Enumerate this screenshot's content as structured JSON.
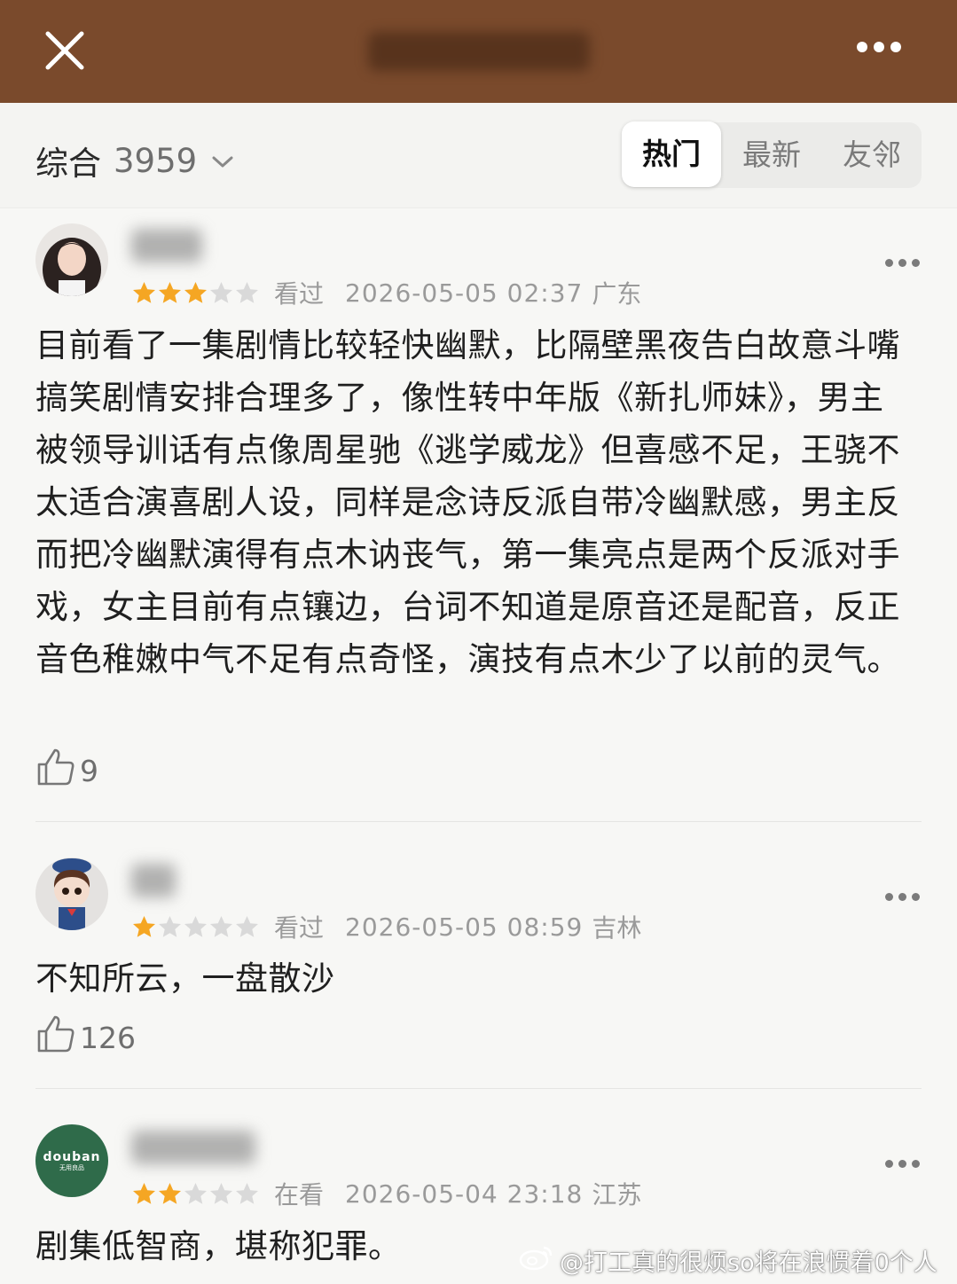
{
  "header": {
    "close_icon": "close-icon",
    "more_icon": "more-horizontal-icon",
    "background": "#7a4a2c"
  },
  "filter": {
    "sort_label": "综合",
    "count": "3959",
    "tabs": [
      {
        "label": "热门",
        "active": true
      },
      {
        "label": "最新",
        "active": false
      },
      {
        "label": "友邻",
        "active": false
      }
    ]
  },
  "reviews": [
    {
      "rating": 3,
      "max_rating": 5,
      "status": "看过",
      "timestamp": "2026-05-05 02:37",
      "location": "广东",
      "text": "目前看了一集剧情比较轻快幽默，比隔壁黑夜告白故意斗嘴搞笑剧情安排合理多了，像性转中年版《新扎师妹》，男主被领导训话有点像周星驰《逃学威龙》但喜感不足，王骁不太适合演喜剧人设，同样是念诗反派自带冷幽默感，男主反而把冷幽默演得有点木讷丧气，第一集亮点是两个反派对手戏，女主目前有点镶边，台词不知道是原音还是配音，反正音色稚嫩中气不足有点奇怪，演技有点木少了以前的灵气。",
      "likes": "9"
    },
    {
      "rating": 1,
      "max_rating": 5,
      "status": "看过",
      "timestamp": "2026-05-05 08:59",
      "location": "吉林",
      "text": "不知所云，一盘散沙",
      "likes": "126"
    },
    {
      "rating": 2,
      "max_rating": 5,
      "status": "在看",
      "timestamp": "2026-05-04 23:18",
      "location": "江苏",
      "text": "剧集低智商，堪称犯罪。",
      "avatar_text": "douban",
      "avatar_subtext": "无用良品"
    }
  ],
  "colors": {
    "star_filled": "#f5a623",
    "star_empty": "#d9d9d9",
    "avatar3_bg": "#2f6b4a"
  },
  "watermark": "@打工真的很烦so将在浪惯着0个人"
}
